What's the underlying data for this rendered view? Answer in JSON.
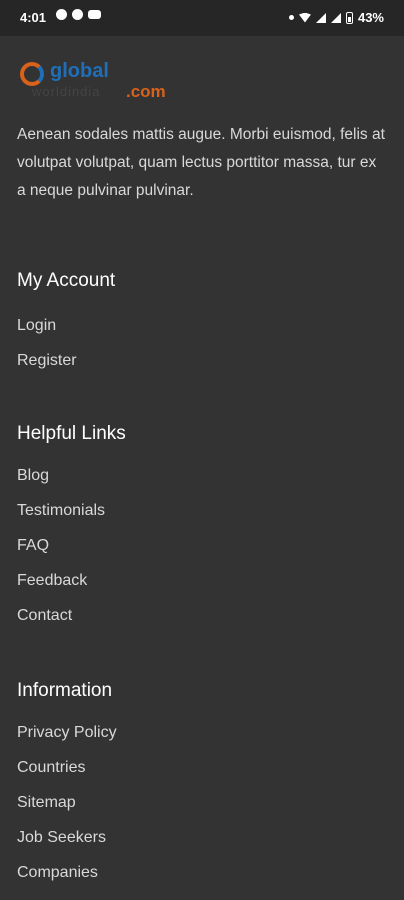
{
  "status_bar": {
    "time": "4:01",
    "battery": "43%",
    "network": "Ɐ"
  },
  "logo": {
    "global": "global",
    "sub": "worldindia",
    "com": ".com"
  },
  "about": "Aenean sodales mattis augue. Morbi euismod, felis at volutpat volutpat, quam lectus porttitor massa, tur ex a neque pulvinar pulvinar.",
  "my_account": {
    "title": "My Account",
    "links": [
      "Login",
      "Register"
    ]
  },
  "helpful_links": {
    "title": "Helpful Links",
    "links": [
      "Blog",
      "Testimonials",
      "FAQ",
      "Feedback",
      "Contact"
    ]
  },
  "information": {
    "title": "Information",
    "links": [
      "Privacy Policy",
      "Countries",
      "Sitemap",
      "Job Seekers",
      "Companies"
    ]
  }
}
